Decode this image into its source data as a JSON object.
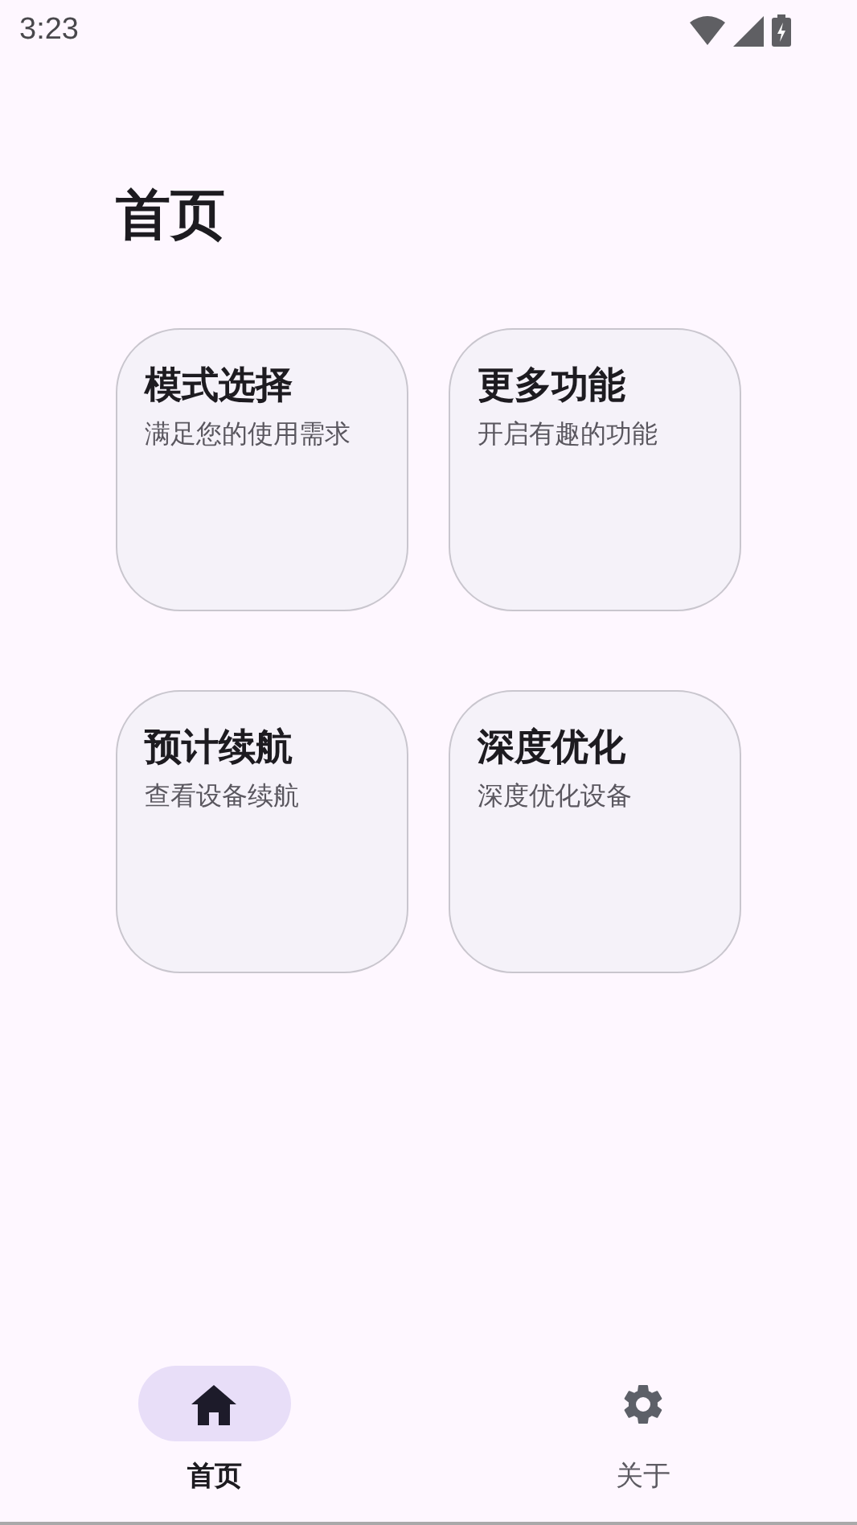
{
  "status_bar": {
    "time": "3:23"
  },
  "page": {
    "title": "首页"
  },
  "cards": [
    {
      "title": "模式选择",
      "subtitle": "满足您的使用需求"
    },
    {
      "title": "更多功能",
      "subtitle": "开启有趣的功能"
    },
    {
      "title": "预计续航",
      "subtitle": "查看设备续航"
    },
    {
      "title": "深度优化",
      "subtitle": "深度优化设备"
    }
  ],
  "nav": [
    {
      "kind": "home",
      "label": "首页",
      "selected": true
    },
    {
      "kind": "settings",
      "label": "关于",
      "selected": false
    }
  ]
}
